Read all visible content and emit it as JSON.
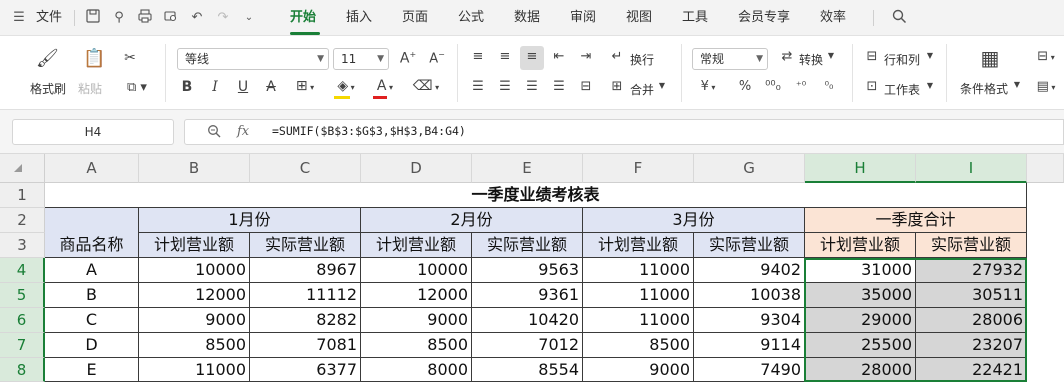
{
  "menu": {
    "file_label": "文件",
    "tabs": [
      {
        "label": "开始",
        "active": true
      },
      {
        "label": "插入"
      },
      {
        "label": "页面"
      },
      {
        "label": "公式"
      },
      {
        "label": "数据"
      },
      {
        "label": "审阅"
      },
      {
        "label": "视图"
      },
      {
        "label": "工具"
      },
      {
        "label": "会员专享"
      },
      {
        "label": "效率"
      }
    ]
  },
  "ribbon": {
    "format_painter": "格式刷",
    "paste": "粘贴",
    "font_name": "等线",
    "font_size": "11",
    "wrap": "换行",
    "merge": "合并",
    "number_format": "常规",
    "convert": "转换",
    "rows_cols": "行和列",
    "worksheet": "工作表",
    "conditional_format": "条件格式",
    "colors": {
      "accent": "#1a7f37",
      "font_color": "#e02020",
      "fill_color": "#f5d800"
    }
  },
  "formula_bar": {
    "cell_ref": "H4",
    "fx": "fx",
    "formula": "=SUMIF($B$3:$G$3,$H$3,B4:G4)"
  },
  "sheet": {
    "columns": [
      "A",
      "B",
      "C",
      "D",
      "E",
      "F",
      "G",
      "H",
      "I"
    ],
    "rows": [
      "1",
      "2",
      "3",
      "4",
      "5",
      "6",
      "7",
      "8"
    ],
    "title": "一季度业绩考核表",
    "months": [
      "1月份",
      "2月份",
      "3月份",
      "一季度合计"
    ],
    "product_header": "商品名称",
    "plan_header": "计划营业额",
    "actual_header": "实际营业额",
    "data": [
      {
        "name": "A",
        "v": [
          "10000",
          "8967",
          "10000",
          "9563",
          "11000",
          "9402",
          "31000",
          "27932"
        ]
      },
      {
        "name": "B",
        "v": [
          "12000",
          "11112",
          "12000",
          "9361",
          "11000",
          "10038",
          "35000",
          "30511"
        ]
      },
      {
        "name": "C",
        "v": [
          "9000",
          "8282",
          "9000",
          "10420",
          "11000",
          "9304",
          "29000",
          "28006"
        ]
      },
      {
        "name": "D",
        "v": [
          "8500",
          "7081",
          "8500",
          "7012",
          "8500",
          "9114",
          "25500",
          "23207"
        ]
      },
      {
        "name": "E",
        "v": [
          "11000",
          "6377",
          "8000",
          "8554",
          "9000",
          "7490",
          "28000",
          "22421"
        ]
      }
    ],
    "selected_range": "H4:I8"
  }
}
